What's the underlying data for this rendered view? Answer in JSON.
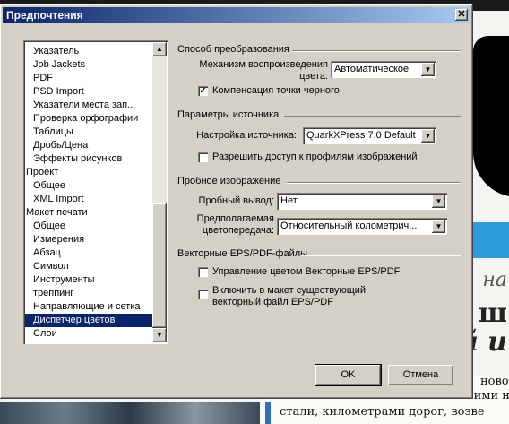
{
  "background_text": {
    "fragment1": "на",
    "fragment2": "ш",
    "fragment3": "й и",
    "line1": "новое эк",
    "line2": "ними н",
    "line3": "стали, километрами дорог, возве"
  },
  "dialog": {
    "title": "Предпочтения",
    "close_glyph": "✕"
  },
  "sidebar": {
    "items": [
      {
        "label": "Указатель",
        "level": 1
      },
      {
        "label": "Job Jackets",
        "level": 1
      },
      {
        "label": "PDF",
        "level": 1
      },
      {
        "label": "PSD Import",
        "level": 1
      },
      {
        "label": "Указатели места зап...",
        "level": 1
      },
      {
        "label": "Проверка орфографии",
        "level": 1
      },
      {
        "label": "Таблицы",
        "level": 1
      },
      {
        "label": "Дробь/Цена",
        "level": 1
      },
      {
        "label": "Эффекты рисунков",
        "level": 1
      },
      {
        "label": "Проект",
        "level": 0
      },
      {
        "label": "Общее",
        "level": 1
      },
      {
        "label": "XML Import",
        "level": 1
      },
      {
        "label": "Макет печати",
        "level": 0
      },
      {
        "label": "Общее",
        "level": 1
      },
      {
        "label": "Измерения",
        "level": 1
      },
      {
        "label": "Абзац",
        "level": 1
      },
      {
        "label": "Символ",
        "level": 1
      },
      {
        "label": "Инструменты",
        "level": 1
      },
      {
        "label": "треппинг",
        "level": 1
      },
      {
        "label": "Направляющие и сетка",
        "level": 1
      },
      {
        "label": "Диспетчер цветов",
        "level": 1,
        "selected": true
      },
      {
        "label": "Слои",
        "level": 1
      }
    ],
    "scroll_up_glyph": "▲",
    "scroll_down_glyph": "▼"
  },
  "conversion": {
    "section_title": "Способ преобразования",
    "engine_label_line1": "Механизм воспроизведения",
    "engine_label_line2": "цвета:",
    "engine_value": "Автоматическое",
    "black_point_label": "Компенсация точки черного",
    "black_point_checked": true
  },
  "source": {
    "section_title": "Параметры источника",
    "setup_label": "Настройка источника:",
    "setup_value": "QuarkXPress 7.0 Default",
    "allow_profiles_label": "Разрешить доступ к профилям изображений",
    "allow_profiles_checked": false
  },
  "proof": {
    "section_title": "Пробное изображение",
    "output_label": "Пробный вывод:",
    "output_value": "Нет",
    "intent_label_line1": "Предполагаемая",
    "intent_label_line2": "цветопередача:",
    "intent_value": "Относительный колометрич..."
  },
  "vector": {
    "section_title": "Векторные EPS/PDF-файлы",
    "manage_label": "Управление цветом Векторные EPS/PDF",
    "manage_checked": false,
    "include_label_line1": "Включить в макет существующий",
    "include_label_line2": "векторный файл EPS/PDF",
    "include_checked": false
  },
  "buttons": {
    "ok": "OK",
    "cancel": "Отмена"
  },
  "icons": {
    "dropdown_arrow": "▼",
    "check_mark": "✓"
  }
}
